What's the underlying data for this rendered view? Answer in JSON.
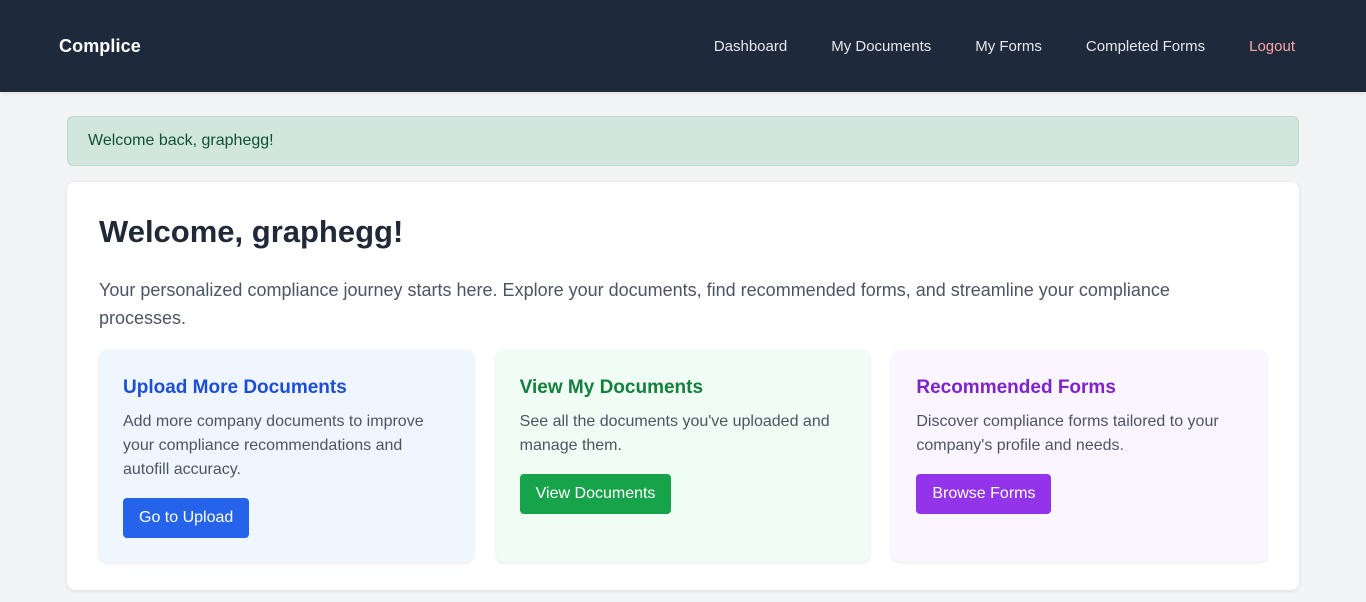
{
  "nav": {
    "brand": "Complice",
    "links": [
      {
        "label": "Dashboard"
      },
      {
        "label": "My Documents"
      },
      {
        "label": "My Forms"
      },
      {
        "label": "Completed Forms"
      },
      {
        "label": "Logout"
      }
    ]
  },
  "alert": {
    "message": "Welcome back, graphegg!"
  },
  "main": {
    "title": "Welcome, graphegg!",
    "intro": "Your personalized compliance journey starts here. Explore your documents, find recommended forms, and streamline your compliance processes.",
    "cards": [
      {
        "title": "Upload More Documents",
        "description": "Add more company documents to improve your compliance recommendations and autofill accuracy.",
        "button": "Go to Upload"
      },
      {
        "title": "View My Documents",
        "description": "See all the documents you've uploaded and manage them.",
        "button": "View Documents"
      },
      {
        "title": "Recommended Forms",
        "description": "Discover compliance forms tailored to your company's profile and needs.",
        "button": "Browse Forms"
      }
    ]
  },
  "colors": {
    "navbar": "#1e293b",
    "blue_accent": "#2563eb",
    "green_accent": "#16a34a",
    "purple_accent": "#9333ea",
    "logout": "#fca5a5",
    "alert_bg": "#d1e7dd"
  }
}
